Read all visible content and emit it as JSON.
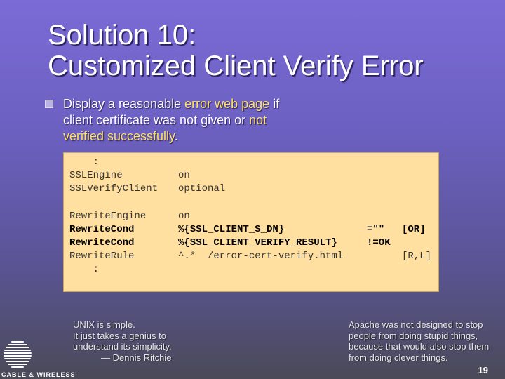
{
  "title": {
    "line1": "Solution 10:",
    "line2": "Customized Client Verify Error"
  },
  "bullet": {
    "text_1": "Display a reasonable ",
    "highlight_1": "error web page",
    "text_2": " if client certificate was not given or ",
    "highlight_2": "not verified successfully",
    "text_3": "."
  },
  "code": {
    "lines": [
      {
        "directive": "    :",
        "args": "",
        "extra": "",
        "flags": ""
      },
      {
        "directive": "SSLEngine",
        "args": "on",
        "extra": "",
        "flags": ""
      },
      {
        "directive": "SSLVerifyClient",
        "args": "optional",
        "extra": "",
        "flags": ""
      },
      {
        "directive": "",
        "args": "",
        "extra": "",
        "flags": ""
      },
      {
        "directive": "RewriteEngine",
        "args": "on",
        "extra": "",
        "flags": ""
      },
      {
        "directive": "RewriteCond",
        "args": "%{SSL_CLIENT_S_DN}",
        "extra": "=\"\"",
        "flags": "[OR]"
      },
      {
        "directive": "RewriteCond",
        "args": "%{SSL_CLIENT_VERIFY_RESULT}",
        "extra": "!=OK",
        "flags": ""
      },
      {
        "directive": "RewriteRule",
        "args": "^.*  /error-cert-verify.html",
        "extra": "",
        "flags": "[R,L]"
      },
      {
        "directive": "    :",
        "args": "",
        "extra": "",
        "flags": ""
      }
    ]
  },
  "quote_left": {
    "line1": "UNIX is simple.",
    "line2": "It just takes a genius to",
    "line3": "understand its simplicity.",
    "attribution": "— Dennis Ritchie"
  },
  "quote_right": {
    "line1": "Apache was not designed to stop",
    "line2": "people from doing stupid things,",
    "line3": "because that would also stop them",
    "line4": "from doing clever things."
  },
  "logo": {
    "text": "CABLE & WIRELESS",
    "icon": "globe-logo-icon"
  },
  "page_number": "19"
}
